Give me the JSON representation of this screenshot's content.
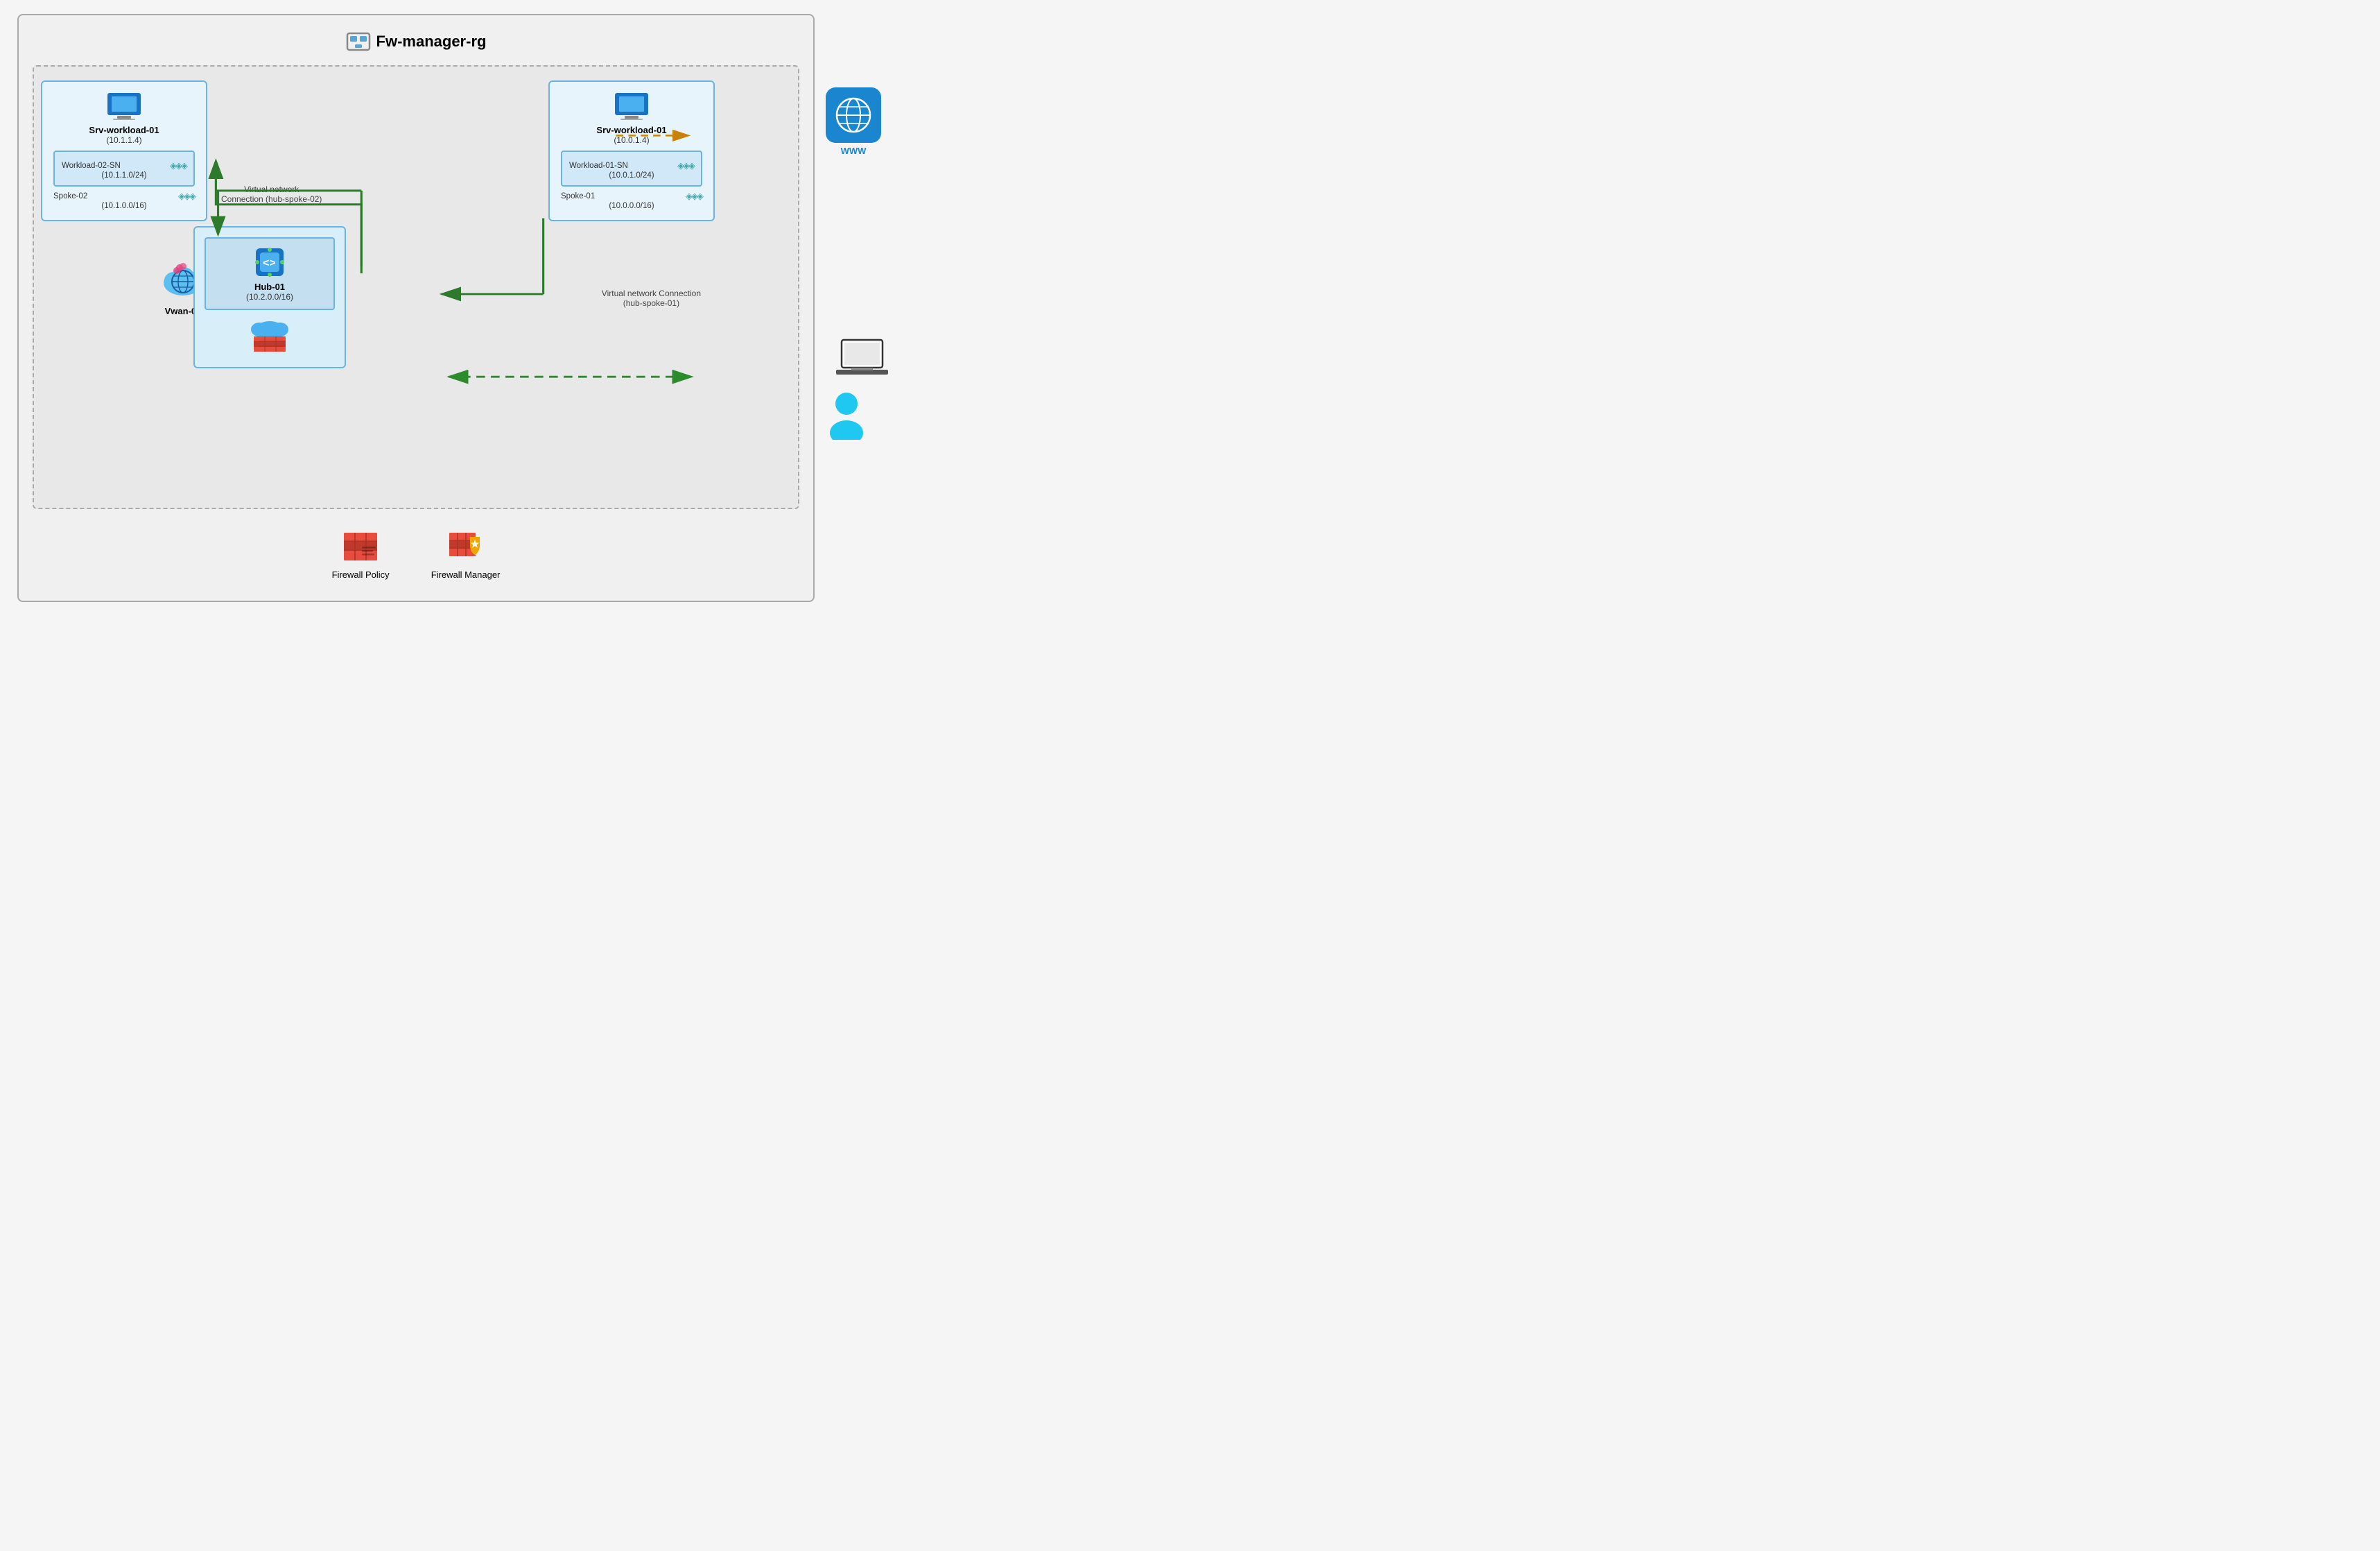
{
  "title": "Fw-manager-rg",
  "spoke02": {
    "vm": "Srv-workload-01",
    "ip": "(10.1.1.4)",
    "subnet_name": "Workload-02-SN",
    "subnet_cidr": "(10.1.1.0/24)",
    "spoke_name": "Spoke-02",
    "spoke_cidr": "(10.1.0.0/16)"
  },
  "spoke01": {
    "vm": "Srv-workload-01",
    "ip": "(10.0.1.4)",
    "subnet_name": "Workload-01-SN",
    "subnet_cidr": "(10.0.1.0/24)",
    "spoke_name": "Spoke-01",
    "spoke_cidr": "(10.0.0.0/16)"
  },
  "hub": {
    "name": "Hub-01",
    "cidr": "(10.2.0.0/16)"
  },
  "vwan": {
    "name": "Vwan-01"
  },
  "connections": {
    "conn1_label1": "Virtual network",
    "conn1_label2": "Connection (hub-spoke-02)",
    "conn2_label1": "Virtual network Connection",
    "conn2_label2": "(hub-spoke-01)"
  },
  "bottomItems": [
    {
      "label": "Firewall Policy",
      "icon": "firewall-policy-icon"
    },
    {
      "label": "Firewall Manager",
      "icon": "firewall-manager-icon"
    }
  ],
  "www_label": "WWW",
  "colors": {
    "arrow_green": "#2d7a2d",
    "arrow_dashed_green": "#2d8a2d",
    "arrow_orange_dashed": "#c8820a",
    "spoke_border": "#6bb3e0",
    "hub_bg": "#d8eef8"
  }
}
